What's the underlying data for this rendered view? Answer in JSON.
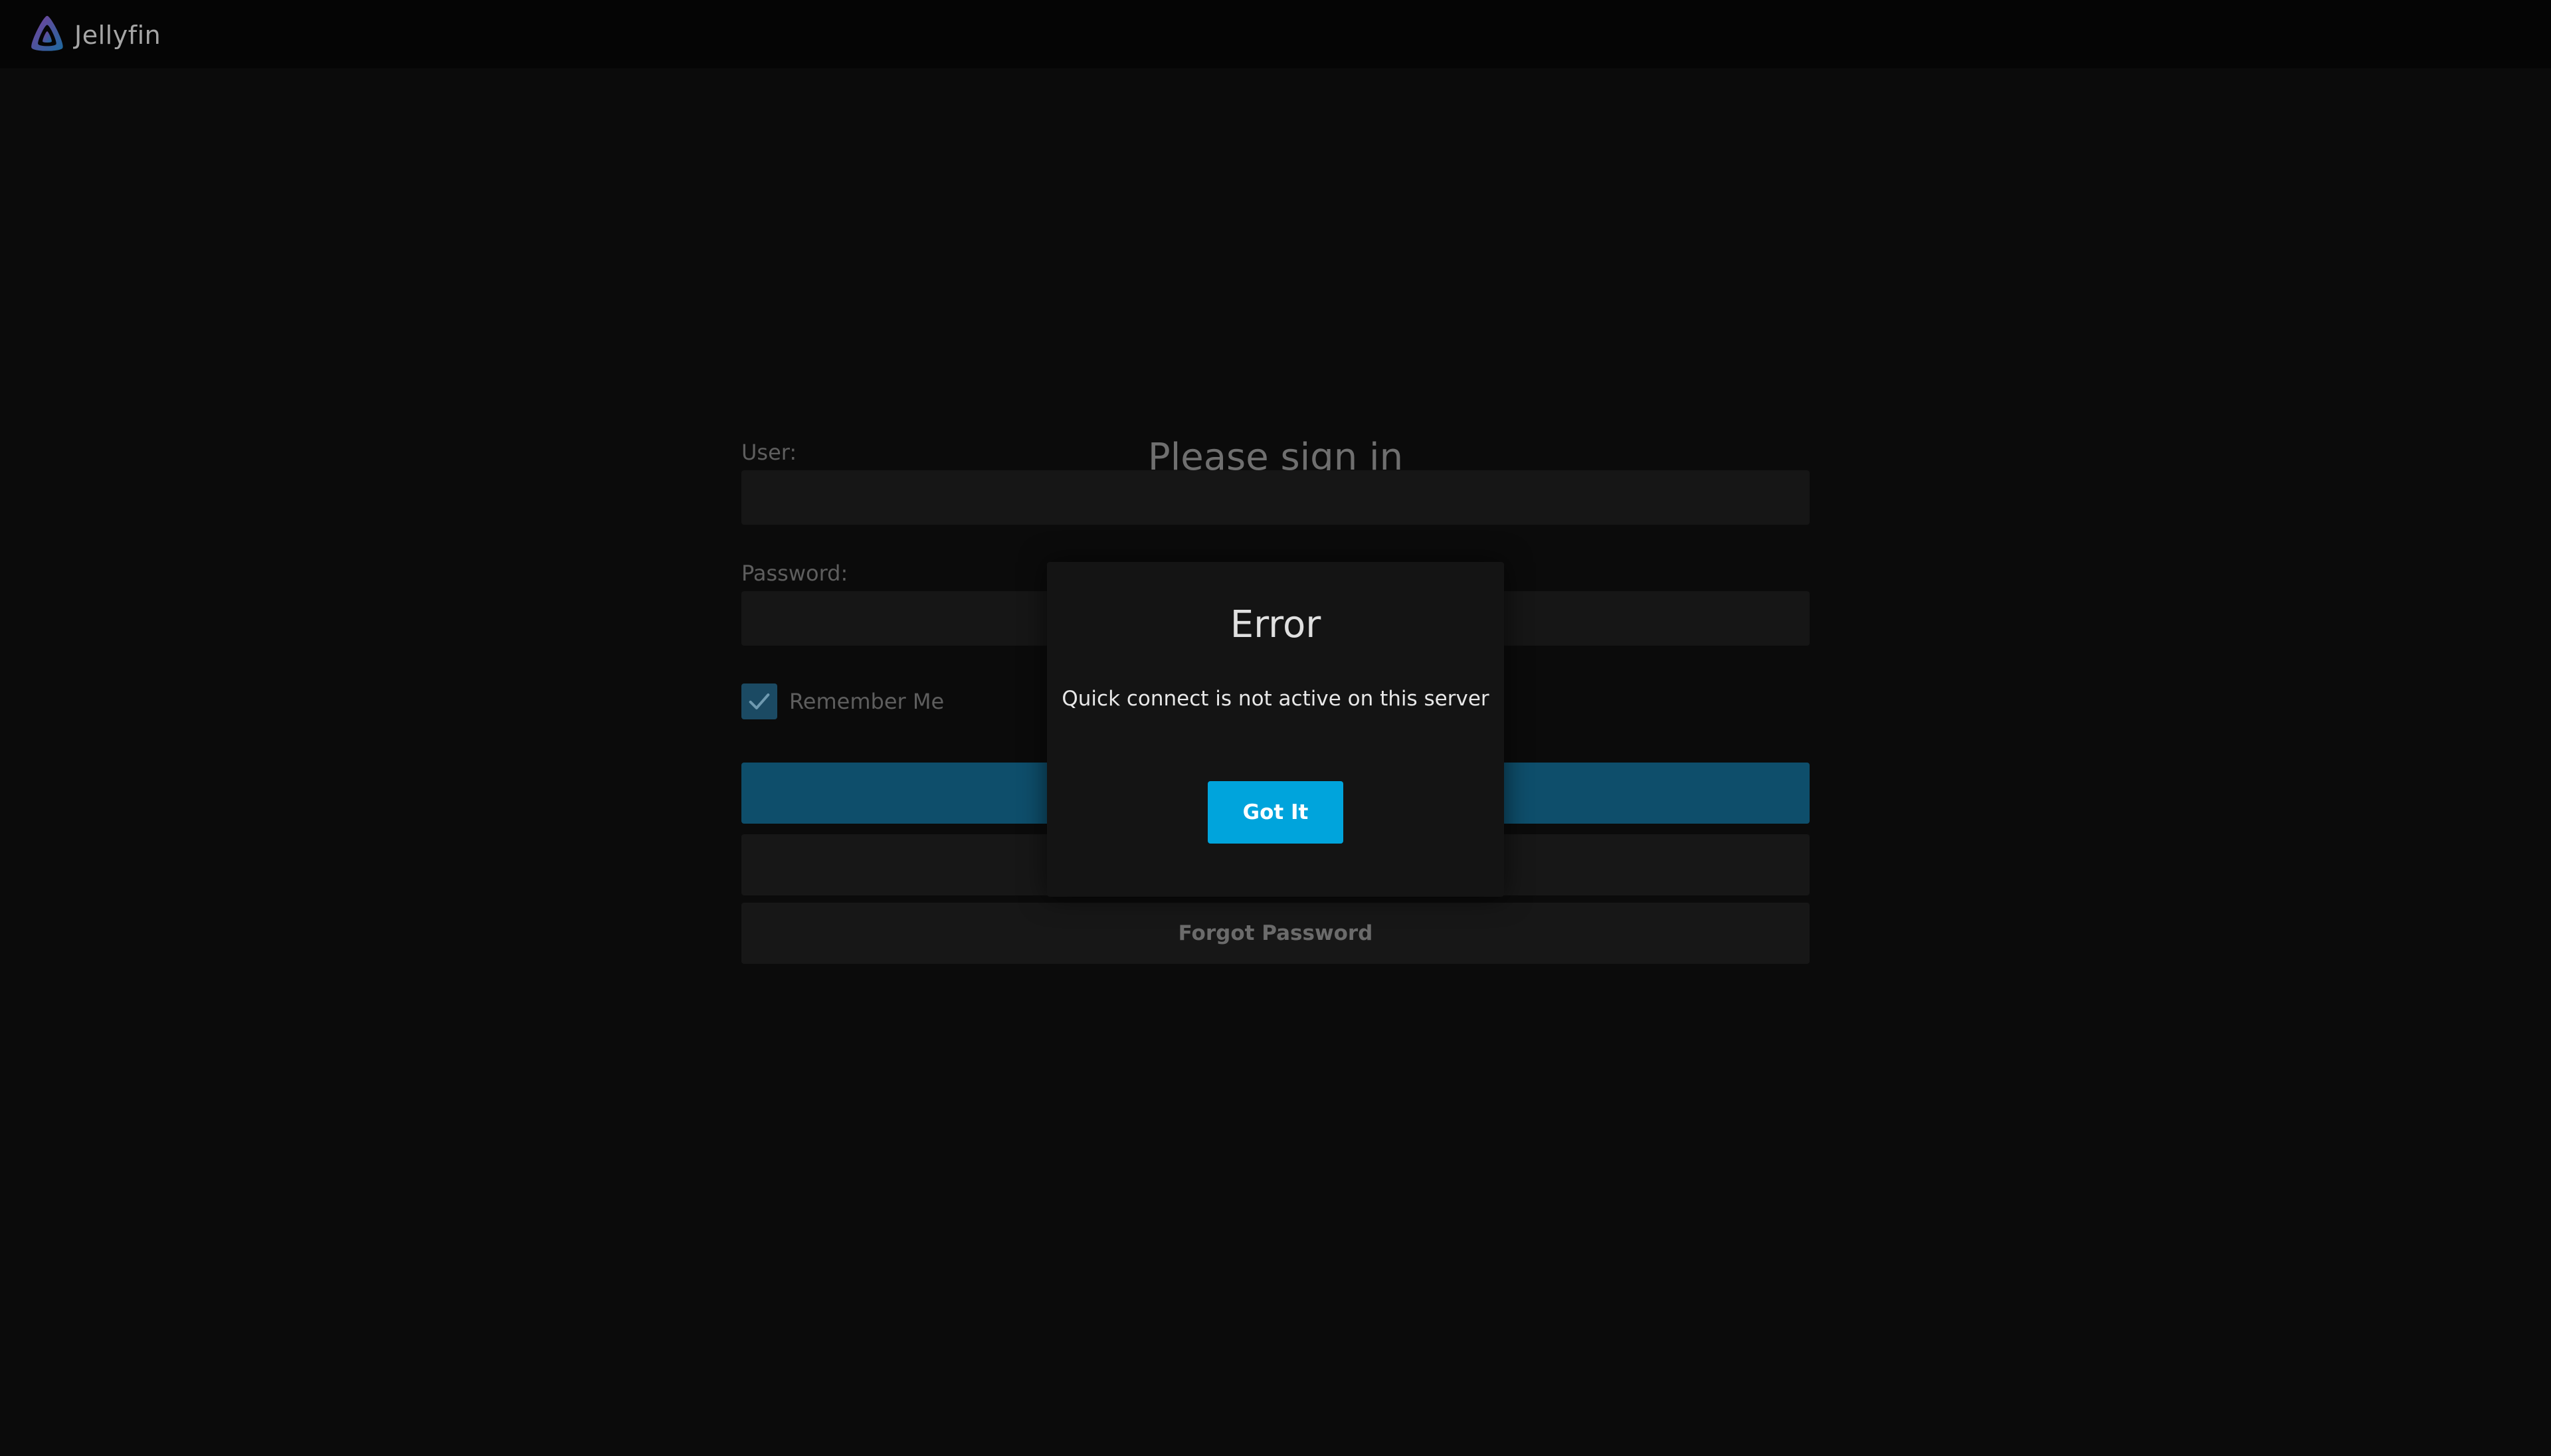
{
  "header": {
    "app_name": "Jellyfin",
    "logo_icon": "jellyfin-logo-icon"
  },
  "login": {
    "title": "Please sign in",
    "user_label": "User:",
    "user_value": "",
    "password_label": "Password:",
    "password_value": "",
    "remember_me_label": "Remember Me",
    "remember_me_checked": true,
    "signin_button_label": "",
    "quick_connect_button_label": "",
    "forgot_password_label": "Forgot Password"
  },
  "dialog": {
    "title": "Error",
    "message": "Quick connect is not active on this server",
    "confirm_label": "Got It"
  },
  "colors": {
    "accent": "#00a4dc",
    "background": "#0b0b0b"
  }
}
